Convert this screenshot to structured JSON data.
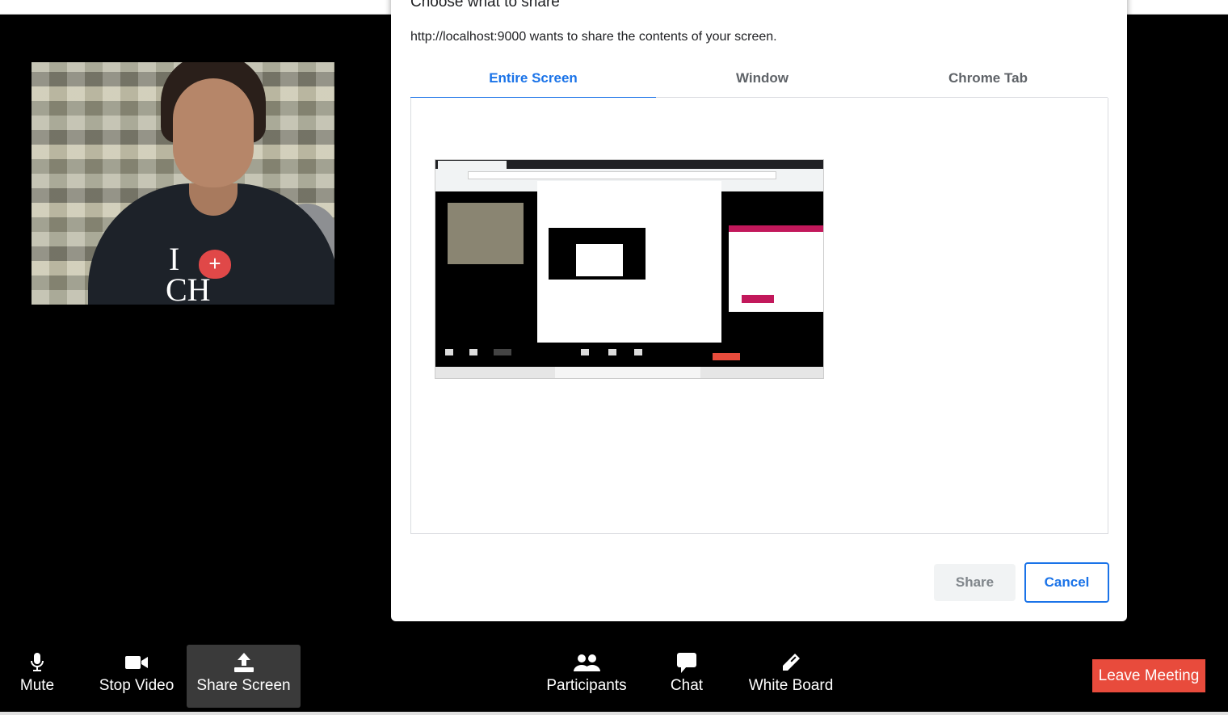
{
  "dialog": {
    "title": "Choose what to share",
    "subtitle": "http://localhost:9000 wants to share the contents of your screen.",
    "tabs": [
      {
        "label": "Entire Screen",
        "active": true
      },
      {
        "label": "Window",
        "active": false
      },
      {
        "label": "Chrome Tab",
        "active": false
      }
    ],
    "share_label": "Share",
    "cancel_label": "Cancel"
  },
  "video": {
    "shirt_text": "I",
    "shirt_text2": "CH"
  },
  "toolbar": {
    "items": [
      {
        "label": "Mute",
        "icon": "microphone-icon"
      },
      {
        "label": "Stop Video",
        "icon": "video-camera-icon"
      },
      {
        "label": "Share Screen",
        "icon": "upload-icon"
      },
      {
        "label": "Participants",
        "icon": "users-icon"
      },
      {
        "label": "Chat",
        "icon": "chat-bubble-icon"
      },
      {
        "label": "White Board",
        "icon": "pencil-icon"
      }
    ],
    "leave_label": "Leave Meeting"
  },
  "colors": {
    "accent": "#1a73e8",
    "leave": "#e84b3c",
    "background": "#000000"
  }
}
